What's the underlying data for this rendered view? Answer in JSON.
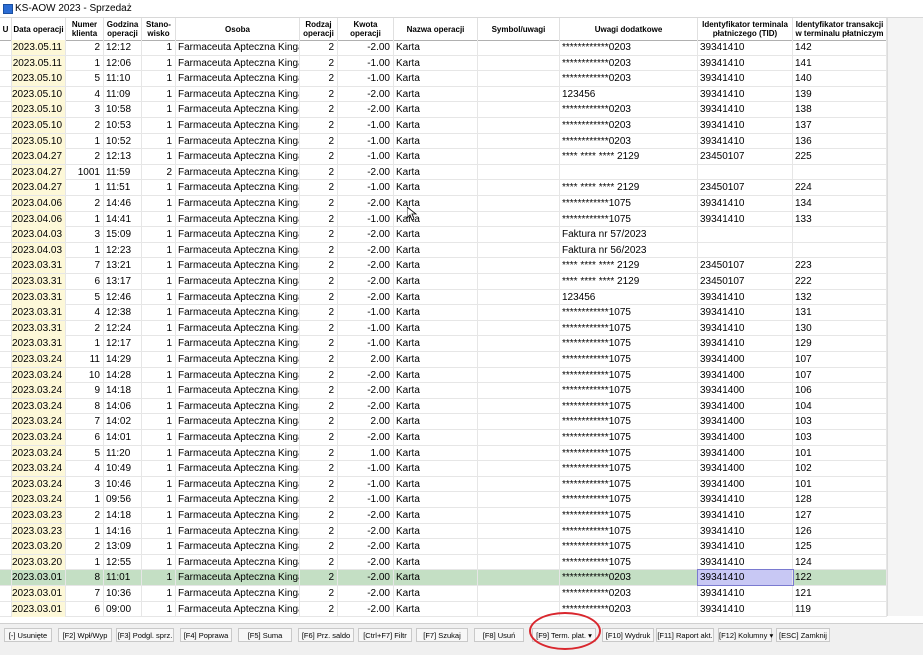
{
  "window": {
    "title": "KS-AOW 2023 - Sprzedaż"
  },
  "columns": [
    {
      "key": "u",
      "label": "U"
    },
    {
      "key": "date",
      "label": "Data operacji"
    },
    {
      "key": "client",
      "label": "Numer\nklienta"
    },
    {
      "key": "time",
      "label": "Godzina\noperacji"
    },
    {
      "key": "station",
      "label": "Stano-\nwisko"
    },
    {
      "key": "person",
      "label": "Osoba"
    },
    {
      "key": "type",
      "label": "Rodzaj\noperacji"
    },
    {
      "key": "amount",
      "label": "Kwota operacji"
    },
    {
      "key": "opname",
      "label": "Nazwa operacji"
    },
    {
      "key": "symbol",
      "label": "Symbol/uwagi"
    },
    {
      "key": "extra",
      "label": "Uwagi dodatkowe"
    },
    {
      "key": "tid",
      "label": "Identyfikator terminala\npłatniczego (TID)"
    },
    {
      "key": "txid",
      "label": "Identyfikator transakcji\nw terminalu płatniczym"
    }
  ],
  "rows": [
    {
      "date": "2023.05.11",
      "client": "2",
      "time": "12:12",
      "station": "1",
      "person": "Farmaceuta Apteczna  Kinga",
      "type": "2",
      "amount": "-2.00",
      "opname": "Karta",
      "symbol": "",
      "extra": "************0203",
      "tid": "39341410",
      "txid": "142"
    },
    {
      "date": "2023.05.11",
      "client": "1",
      "time": "12:06",
      "station": "1",
      "person": "Farmaceuta Apteczna  Kinga",
      "type": "2",
      "amount": "-1.00",
      "opname": "Karta",
      "symbol": "",
      "extra": "************0203",
      "tid": "39341410",
      "txid": "141"
    },
    {
      "date": "2023.05.10",
      "client": "5",
      "time": "11:10",
      "station": "1",
      "person": "Farmaceuta Apteczna  Kinga",
      "type": "2",
      "amount": "-1.00",
      "opname": "Karta",
      "symbol": "",
      "extra": "************0203",
      "tid": "39341410",
      "txid": "140"
    },
    {
      "date": "2023.05.10",
      "client": "4",
      "time": "11:09",
      "station": "1",
      "person": "Farmaceuta Apteczna  Kinga",
      "type": "2",
      "amount": "-2.00",
      "opname": "Karta",
      "symbol": "",
      "extra": "123456",
      "tid": "39341410",
      "txid": "139"
    },
    {
      "date": "2023.05.10",
      "client": "3",
      "time": "10:58",
      "station": "1",
      "person": "Farmaceuta Apteczna  Kinga",
      "type": "2",
      "amount": "-2.00",
      "opname": "Karta",
      "symbol": "",
      "extra": "************0203",
      "tid": "39341410",
      "txid": "138"
    },
    {
      "date": "2023.05.10",
      "client": "2",
      "time": "10:53",
      "station": "1",
      "person": "Farmaceuta Apteczna  Kinga",
      "type": "2",
      "amount": "-1.00",
      "opname": "Karta",
      "symbol": "",
      "extra": "************0203",
      "tid": "39341410",
      "txid": "137"
    },
    {
      "date": "2023.05.10",
      "client": "1",
      "time": "10:52",
      "station": "1",
      "person": "Farmaceuta Apteczna  Kinga",
      "type": "2",
      "amount": "-1.00",
      "opname": "Karta",
      "symbol": "",
      "extra": "************0203",
      "tid": "39341410",
      "txid": "136"
    },
    {
      "date": "2023.04.27",
      "client": "2",
      "time": "12:13",
      "station": "1",
      "person": "Farmaceuta Apteczna  Kinga",
      "type": "2",
      "amount": "-1.00",
      "opname": "Karta",
      "symbol": "",
      "extra": "**** **** **** 2129",
      "tid": "23450107",
      "txid": "225"
    },
    {
      "date": "2023.04.27",
      "client": "1001",
      "time": "11:59",
      "station": "2",
      "person": "Farmaceuta Apteczna  Kinga",
      "type": "2",
      "amount": "-2.00",
      "opname": "Karta",
      "symbol": "",
      "extra": "",
      "tid": "",
      "txid": ""
    },
    {
      "date": "2023.04.27",
      "client": "1",
      "time": "11:51",
      "station": "1",
      "person": "Farmaceuta Apteczna  Kinga",
      "type": "2",
      "amount": "-1.00",
      "opname": "Karta",
      "symbol": "",
      "extra": "**** **** **** 2129",
      "tid": "23450107",
      "txid": "224"
    },
    {
      "date": "2023.04.06",
      "client": "2",
      "time": "14:46",
      "station": "1",
      "person": "Farmaceuta Apteczna  Kinga",
      "type": "2",
      "amount": "-2.00",
      "opname": "Karta",
      "symbol": "",
      "extra": "************1075",
      "tid": "39341410",
      "txid": "134"
    },
    {
      "date": "2023.04.06",
      "client": "1",
      "time": "14:41",
      "station": "1",
      "person": "Farmaceuta Apteczna  Kinga",
      "type": "2",
      "amount": "-1.00",
      "opname": "Karta",
      "symbol": "",
      "extra": "************1075",
      "tid": "39341410",
      "txid": "133"
    },
    {
      "date": "2023.04.03",
      "client": "3",
      "time": "15:09",
      "station": "1",
      "person": "Farmaceuta Apteczna  Kinga",
      "type": "2",
      "amount": "-2.00",
      "opname": "Karta",
      "symbol": "",
      "extra": "Faktura nr 57/2023",
      "tid": "",
      "txid": ""
    },
    {
      "date": "2023.04.03",
      "client": "1",
      "time": "12:23",
      "station": "1",
      "person": "Farmaceuta Apteczna  Kinga",
      "type": "2",
      "amount": "-2.00",
      "opname": "Karta",
      "symbol": "",
      "extra": "Faktura nr 56/2023",
      "tid": "",
      "txid": ""
    },
    {
      "date": "2023.03.31",
      "client": "7",
      "time": "13:21",
      "station": "1",
      "person": "Farmaceuta Apteczna  Kinga",
      "type": "2",
      "amount": "-2.00",
      "opname": "Karta",
      "symbol": "",
      "extra": "**** **** **** 2129",
      "tid": "23450107",
      "txid": "223"
    },
    {
      "date": "2023.03.31",
      "client": "6",
      "time": "13:17",
      "station": "1",
      "person": "Farmaceuta Apteczna  Kinga",
      "type": "2",
      "amount": "-2.00",
      "opname": "Karta",
      "symbol": "",
      "extra": "**** **** **** 2129",
      "tid": "23450107",
      "txid": "222"
    },
    {
      "date": "2023.03.31",
      "client": "5",
      "time": "12:46",
      "station": "1",
      "person": "Farmaceuta Apteczna  Kinga",
      "type": "2",
      "amount": "-2.00",
      "opname": "Karta",
      "symbol": "",
      "extra": "123456",
      "tid": "39341410",
      "txid": "132"
    },
    {
      "date": "2023.03.31",
      "client": "4",
      "time": "12:38",
      "station": "1",
      "person": "Farmaceuta Apteczna  Kinga",
      "type": "2",
      "amount": "-1.00",
      "opname": "Karta",
      "symbol": "",
      "extra": "************1075",
      "tid": "39341410",
      "txid": "131"
    },
    {
      "date": "2023.03.31",
      "client": "2",
      "time": "12:24",
      "station": "1",
      "person": "Farmaceuta Apteczna  Kinga",
      "type": "2",
      "amount": "-1.00",
      "opname": "Karta",
      "symbol": "",
      "extra": "************1075",
      "tid": "39341410",
      "txid": "130"
    },
    {
      "date": "2023.03.31",
      "client": "1",
      "time": "12:17",
      "station": "1",
      "person": "Farmaceuta Apteczna  Kinga",
      "type": "2",
      "amount": "-1.00",
      "opname": "Karta",
      "symbol": "",
      "extra": "************1075",
      "tid": "39341410",
      "txid": "129"
    },
    {
      "date": "2023.03.24",
      "client": "11",
      "time": "14:29",
      "station": "1",
      "person": "Farmaceuta Apteczna  Kinga",
      "type": "2",
      "amount": "2.00",
      "opname": "Karta",
      "symbol": "",
      "extra": "************1075",
      "tid": "39341400",
      "txid": "107"
    },
    {
      "date": "2023.03.24",
      "client": "10",
      "time": "14:28",
      "station": "1",
      "person": "Farmaceuta Apteczna  Kinga",
      "type": "2",
      "amount": "-2.00",
      "opname": "Karta",
      "symbol": "",
      "extra": "************1075",
      "tid": "39341400",
      "txid": "107"
    },
    {
      "date": "2023.03.24",
      "client": "9",
      "time": "14:18",
      "station": "1",
      "person": "Farmaceuta Apteczna  Kinga",
      "type": "2",
      "amount": "-2.00",
      "opname": "Karta",
      "symbol": "",
      "extra": "************1075",
      "tid": "39341400",
      "txid": "106"
    },
    {
      "date": "2023.03.24",
      "client": "8",
      "time": "14:06",
      "station": "1",
      "person": "Farmaceuta Apteczna  Kinga",
      "type": "2",
      "amount": "-2.00",
      "opname": "Karta",
      "symbol": "",
      "extra": "************1075",
      "tid": "39341400",
      "txid": "104"
    },
    {
      "date": "2023.03.24",
      "client": "7",
      "time": "14:02",
      "station": "1",
      "person": "Farmaceuta Apteczna  Kinga",
      "type": "2",
      "amount": "2.00",
      "opname": "Karta",
      "symbol": "",
      "extra": "************1075",
      "tid": "39341400",
      "txid": "103"
    },
    {
      "date": "2023.03.24",
      "client": "6",
      "time": "14:01",
      "station": "1",
      "person": "Farmaceuta Apteczna  Kinga",
      "type": "2",
      "amount": "-2.00",
      "opname": "Karta",
      "symbol": "",
      "extra": "************1075",
      "tid": "39341400",
      "txid": "103"
    },
    {
      "date": "2023.03.24",
      "client": "5",
      "time": "11:20",
      "station": "1",
      "person": "Farmaceuta Apteczna  Kinga",
      "type": "2",
      "amount": "1.00",
      "opname": "Karta",
      "symbol": "",
      "extra": "************1075",
      "tid": "39341400",
      "txid": "101"
    },
    {
      "date": "2023.03.24",
      "client": "4",
      "time": "10:49",
      "station": "1",
      "person": "Farmaceuta Apteczna  Kinga",
      "type": "2",
      "amount": "-1.00",
      "opname": "Karta",
      "symbol": "",
      "extra": "************1075",
      "tid": "39341400",
      "txid": "102"
    },
    {
      "date": "2023.03.24",
      "client": "3",
      "time": "10:46",
      "station": "1",
      "person": "Farmaceuta Apteczna  Kinga",
      "type": "2",
      "amount": "-1.00",
      "opname": "Karta",
      "symbol": "",
      "extra": "************1075",
      "tid": "39341400",
      "txid": "101"
    },
    {
      "date": "2023.03.24",
      "client": "1",
      "time": "09:56",
      "station": "1",
      "person": "Farmaceuta Apteczna  Kinga",
      "type": "2",
      "amount": "-1.00",
      "opname": "Karta",
      "symbol": "",
      "extra": "************1075",
      "tid": "39341410",
      "txid": "128"
    },
    {
      "date": "2023.03.23",
      "client": "2",
      "time": "14:18",
      "station": "1",
      "person": "Farmaceuta Apteczna  Kinga",
      "type": "2",
      "amount": "-2.00",
      "opname": "Karta",
      "symbol": "",
      "extra": "************1075",
      "tid": "39341410",
      "txid": "127"
    },
    {
      "date": "2023.03.23",
      "client": "1",
      "time": "14:16",
      "station": "1",
      "person": "Farmaceuta Apteczna  Kinga",
      "type": "2",
      "amount": "-2.00",
      "opname": "Karta",
      "symbol": "",
      "extra": "************1075",
      "tid": "39341410",
      "txid": "126"
    },
    {
      "date": "2023.03.20",
      "client": "2",
      "time": "13:09",
      "station": "1",
      "person": "Farmaceuta Apteczna  Kinga",
      "type": "2",
      "amount": "-2.00",
      "opname": "Karta",
      "symbol": "",
      "extra": "************1075",
      "tid": "39341410",
      "txid": "125"
    },
    {
      "date": "2023.03.20",
      "client": "1",
      "time": "12:55",
      "station": "1",
      "person": "Farmaceuta Apteczna  Kinga",
      "type": "2",
      "amount": "-2.00",
      "opname": "Karta",
      "symbol": "",
      "extra": "************1075",
      "tid": "39341410",
      "txid": "124"
    },
    {
      "date": "2023.03.01",
      "client": "8",
      "time": "11:01",
      "station": "1",
      "person": "Farmaceuta Apteczna  Kinga",
      "type": "2",
      "amount": "-2.00",
      "opname": "Karta",
      "symbol": "",
      "extra": "************0203",
      "tid": "39341410",
      "txid": "122",
      "selected": true
    },
    {
      "date": "2023.03.01",
      "client": "7",
      "time": "10:36",
      "station": "1",
      "person": "Farmaceuta Apteczna  Kinga",
      "type": "2",
      "amount": "-2.00",
      "opname": "Karta",
      "symbol": "",
      "extra": "************0203",
      "tid": "39341410",
      "txid": "121"
    },
    {
      "date": "2023.03.01",
      "client": "6",
      "time": "09:00",
      "station": "1",
      "person": "Farmaceuta Apteczna  Kinga",
      "type": "2",
      "amount": "-2.00",
      "opname": "Karta",
      "symbol": "",
      "extra": "************0203",
      "tid": "39341410",
      "txid": "119"
    }
  ],
  "toolbar": {
    "buttons": [
      {
        "name": "usuniete-button",
        "label": "[-] Usunięte"
      },
      {
        "name": "wplyw-button",
        "label": "[F2] Wpł/Wyp"
      },
      {
        "name": "podgl-sprz-button",
        "label": "[F3] Podgl. sprz."
      },
      {
        "name": "poprawa-button",
        "label": "[F4] Poprawa"
      },
      {
        "name": "suma-button",
        "label": "[F5] Suma"
      },
      {
        "name": "prz-saldo-button",
        "label": "[F6] Prz. saldo"
      },
      {
        "name": "filtr-button",
        "label": "[Ctrl+F7] Filtr"
      },
      {
        "name": "szukaj-button",
        "label": "[F7] Szukaj"
      },
      {
        "name": "usun-button",
        "label": "[F8] Usuń"
      },
      {
        "name": "term-plat-button",
        "label": "[F9] Term. plat. ▾"
      },
      {
        "name": "wydruk-button",
        "label": "[F10] Wydruk"
      },
      {
        "name": "raport-akt-button",
        "label": "[F11] Raport akt."
      },
      {
        "name": "kolumny-button",
        "label": "[F12] Kolumny ▾"
      },
      {
        "name": "zamknij-button",
        "label": "[ESC] Zamknij"
      }
    ]
  },
  "colors": {
    "selected_row": "#c4dfc4",
    "date_column": "#fdf8d8",
    "highlight_circle": "#d9272e",
    "tid_cell_selected": "#c8c8f4"
  }
}
